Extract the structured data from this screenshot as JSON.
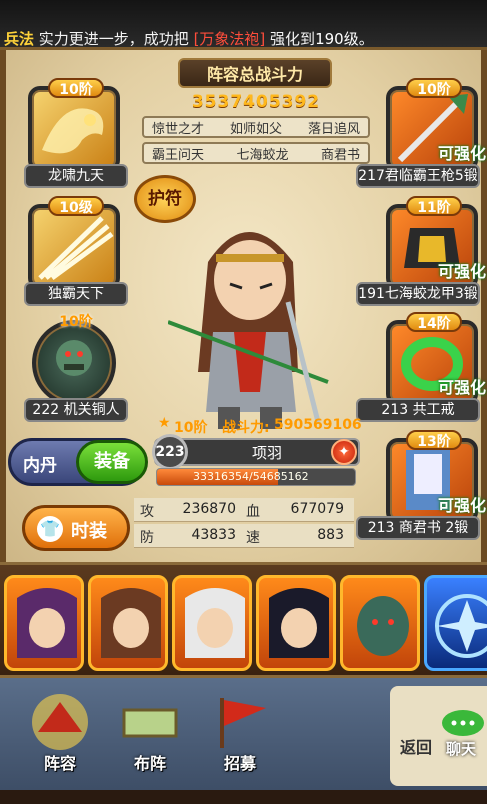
{
  "ticker": {
    "category": "兵法",
    "pre": " 实力更进一步，成功把 ",
    "item": "[万象法袍]",
    "post": " 强化到",
    "level": "190级。"
  },
  "lineup": {
    "title": "阵容总战斗力",
    "total_power": "3537405392",
    "tags_row1": [
      "惊世之才",
      "如师如父",
      "落日追风"
    ],
    "tags_row2": [
      "霸王问天",
      "七海蛟龙",
      "商君书"
    ]
  },
  "left_slots": [
    {
      "tier": "10阶",
      "label": "龙啸九天"
    },
    {
      "tier": "10级",
      "label": "独霸天下"
    },
    {
      "tier": "10阶",
      "label": "222 机关铜人"
    }
  ],
  "right_slots": [
    {
      "tier": "10阶",
      "label": "217君临霸王枪5锻",
      "enhance": "可强化"
    },
    {
      "tier": "11阶",
      "label": "191七海蛟龙甲3锻",
      "enhance": "可强化"
    },
    {
      "tier": "14阶",
      "label": "213   共工戒",
      "enhance": "可强化"
    },
    {
      "tier": "13阶",
      "label": "213  商君书  2锻",
      "enhance": "可强化"
    }
  ],
  "amulet_label": "护符",
  "hero": {
    "tier": "10阶",
    "combat_label": "战斗力:",
    "combat_value": "590569106",
    "level": "223",
    "name": "项羽",
    "exp_text": "33316354/54685162",
    "exp_fraction": 0.609
  },
  "neidan_label": "内丹",
  "equip_label": "装备",
  "costume_label": "时装",
  "stats": {
    "atk_label": "攻",
    "atk": "236870",
    "hp_label": "血",
    "hp": "677079",
    "def_label": "防",
    "def": "43833",
    "spd_label": "速",
    "spd": "883"
  },
  "nav": {
    "lineup": "阵容",
    "formation": "布阵",
    "recruit": "招募",
    "back": "返回",
    "chat": "聊天"
  },
  "colors": {
    "gold": "#ffb81c",
    "enhance_green": "#1a7a1a",
    "frame_orange": "#ff8a2a"
  }
}
